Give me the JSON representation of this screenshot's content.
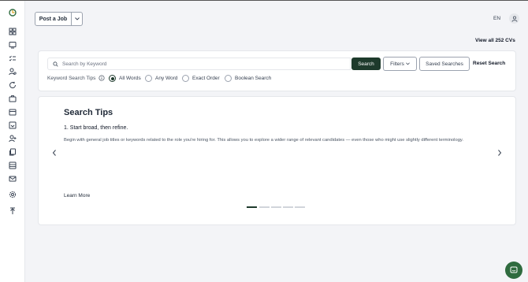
{
  "header": {
    "post_job_label": "Post a Job",
    "language": "EN"
  },
  "view_all_cvs": "View all 252 CVs",
  "search": {
    "placeholder": "Search by Keyword",
    "value": "",
    "search_button": "Search",
    "filters_button": "Filters",
    "saved_searches_button": "Saved Searches",
    "reset_button": "Reset Search",
    "tips_label": "Keyword Search Tips",
    "options": [
      "All Words",
      "Any Word",
      "Exact Order",
      "Boolean Search"
    ],
    "selected_option": "All Words"
  },
  "tips": {
    "title": "Search Tips",
    "subtitle": "1. Start broad, then refine.",
    "body": "Begin with general job titles or keywords related to the role you're hiring for. This allows you to explore a wider range of relevant candidates — even those who might use slightly different terminology.",
    "learn_more": "Learn More",
    "slide_count": 5,
    "active_slide": 1
  },
  "sidebar": {
    "icons": [
      "logo-icon",
      "dashboard-icon",
      "monitor-icon",
      "tasks-icon",
      "candidates-icon",
      "refresh-icon",
      "briefcase-icon",
      "calendar-icon",
      "inbox-icon",
      "add-user-icon",
      "documents-icon",
      "table-icon",
      "mail-icon",
      "settings-icon",
      "upload-icon"
    ]
  },
  "colors": {
    "accent": "#1e3a2c",
    "chat": "#2f6b3f",
    "background": "#f3f4f7"
  }
}
